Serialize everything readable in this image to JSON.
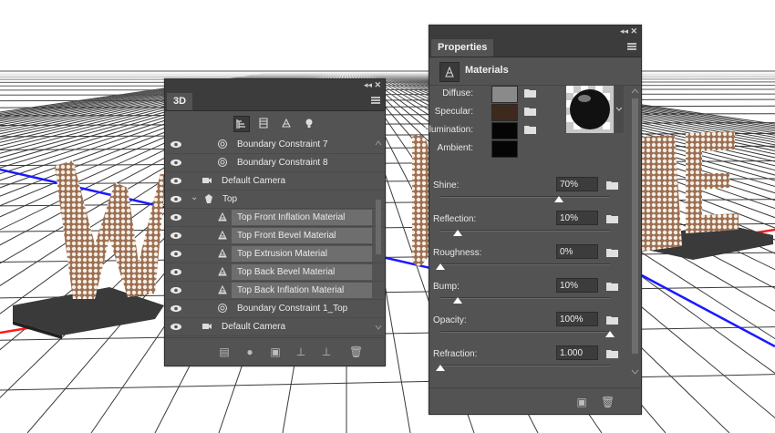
{
  "panel3d": {
    "tab": "3D",
    "layers": [
      {
        "label": "Boundary Constraint 7",
        "type": "constraint",
        "selected": false
      },
      {
        "label": "Boundary Constraint 8",
        "type": "constraint",
        "selected": false
      },
      {
        "label": "Default Camera",
        "type": "camera",
        "selected": false
      },
      {
        "label": "Top",
        "type": "mesh",
        "selected": false
      },
      {
        "label": "Top Front Inflation Material",
        "type": "material",
        "selected": true
      },
      {
        "label": "Top Front Bevel Material",
        "type": "material",
        "selected": true
      },
      {
        "label": "Top Extrusion Material",
        "type": "material",
        "selected": true
      },
      {
        "label": "Top Back Bevel Material",
        "type": "material",
        "selected": true
      },
      {
        "label": "Top Back Inflation Material",
        "type": "material",
        "selected": true
      },
      {
        "label": "Boundary Constraint 1_Top",
        "type": "constraint",
        "selected": false
      },
      {
        "label": "Default Camera",
        "type": "camera",
        "selected": false
      }
    ]
  },
  "properties": {
    "tab": "Properties",
    "section": "Materials",
    "swatches": [
      {
        "label": "Diffuse:",
        "color": "#8a8a8a"
      },
      {
        "label": "Specular:",
        "color": "#3e2a1c"
      },
      {
        "label": "Illumination:",
        "color": "#050505"
      },
      {
        "label": "Ambient:",
        "color": "#050505"
      }
    ],
    "sliders": [
      {
        "label": "Shine:",
        "value": "70%",
        "level": 0.7
      },
      {
        "label": "Reflection:",
        "value": "10%",
        "level": 0.1
      },
      {
        "label": "Roughness:",
        "value": "0%",
        "level": 0.0
      },
      {
        "label": "Bump:",
        "value": "10%",
        "level": 0.1
      },
      {
        "label": "Opacity:",
        "value": "100%",
        "level": 1.0
      },
      {
        "label": "Refraction:",
        "value": "1.000",
        "level": 0.0
      }
    ]
  },
  "colors": {
    "panel_bg": "#535353",
    "accent_blue": "#2a2aff",
    "accent_red": "#ff2020",
    "letters": "#c9a489"
  }
}
